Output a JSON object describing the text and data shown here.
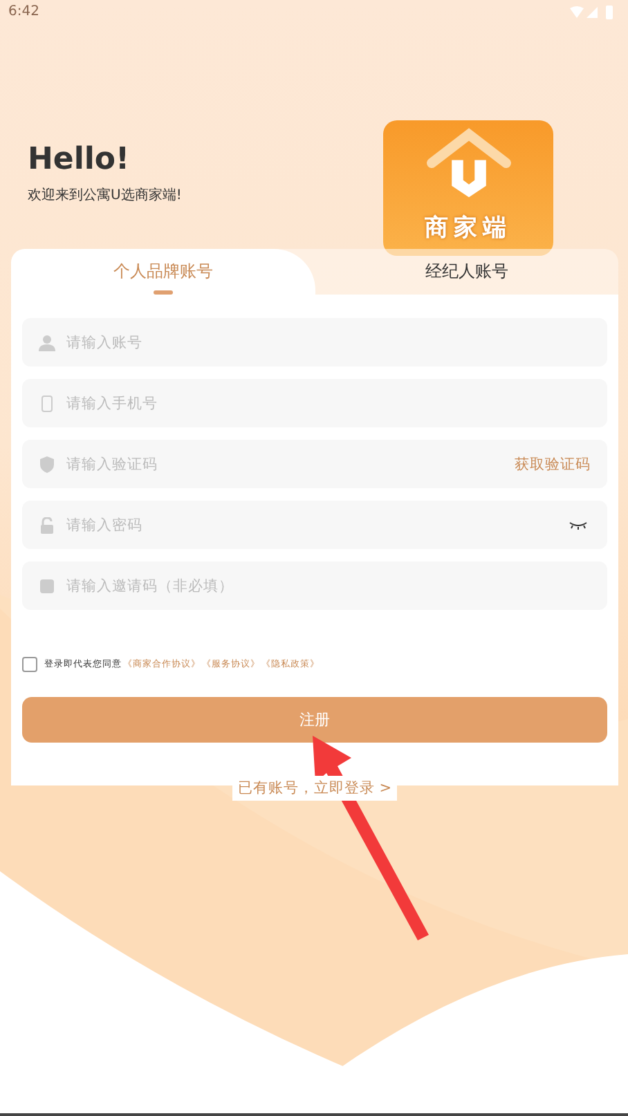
{
  "status_bar": {
    "time": "6:42"
  },
  "header": {
    "title": "Hello!",
    "subtitle": "欢迎来到公寓U选商家端!",
    "logo_text": "商家端"
  },
  "tabs": [
    {
      "label": "个人品牌账号",
      "selected": true
    },
    {
      "label": "经纪人账号",
      "selected": false
    }
  ],
  "fields": [
    {
      "kind": "account",
      "placeholder": "请输入账号"
    },
    {
      "kind": "phone",
      "placeholder": "请输入手机号"
    },
    {
      "kind": "code",
      "placeholder": "请输入验证码",
      "action": "获取验证码"
    },
    {
      "kind": "password",
      "placeholder": "请输入密码",
      "eye": true
    },
    {
      "kind": "invite",
      "placeholder": "请输入邀请码（非必填）"
    }
  ],
  "agreement": {
    "checked": false,
    "text": "登录即代表您同意",
    "links": [
      "《商家合作协议》",
      "《服务协议》",
      "《隐私政策》"
    ]
  },
  "register_button": "注册",
  "login_link": "已有账号，立即登录 >"
}
